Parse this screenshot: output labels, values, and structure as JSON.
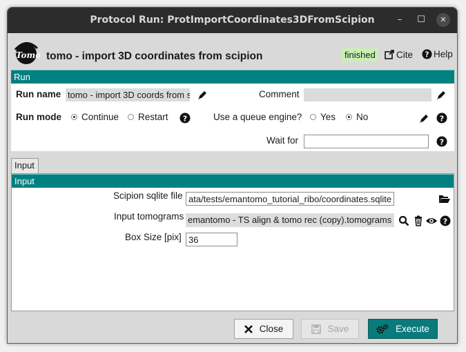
{
  "window": {
    "title": "Protocol Run: ProtImportCoordinates3DFromScipion",
    "minimize": "–",
    "maximize": "☐",
    "close": "✕"
  },
  "header": {
    "logo_text": "Tomo",
    "title": "tomo - import 3D coordinates from scipion",
    "status": "finished",
    "cite": "Cite",
    "help": "Help"
  },
  "run_section": {
    "title": "Run",
    "run_name_label": "Run name",
    "run_name_value": "tomo - import 3D coords from s",
    "comment_label": "Comment",
    "comment_value": "",
    "run_mode_label": "Run mode",
    "run_mode_options": [
      "Continue",
      "Restart"
    ],
    "run_mode_selected": "Continue",
    "queue_label": "Use a queue engine?",
    "queue_options": [
      "Yes",
      "No"
    ],
    "queue_selected": "No",
    "wait_for_label": "Wait for",
    "wait_for_value": ""
  },
  "tabs": [
    "Input"
  ],
  "input_section": {
    "title": "Input",
    "sqlite_label": "Scipion sqlite file",
    "sqlite_value": "ata/tests/emantomo_tutorial_ribo/coordinates.sqlite",
    "tomograms_label": "Input tomograms",
    "tomograms_value": "emantomo - TS align & tomo rec (copy).tomograms",
    "boxsize_label": "Box Size [pix]",
    "boxsize_value": "36"
  },
  "footer": {
    "close": "Close",
    "save": "Save",
    "execute": "Execute"
  },
  "colors": {
    "accent": "#008080",
    "status_bg": "#c9f0b3",
    "execute_bg": "#0a7a7a"
  }
}
